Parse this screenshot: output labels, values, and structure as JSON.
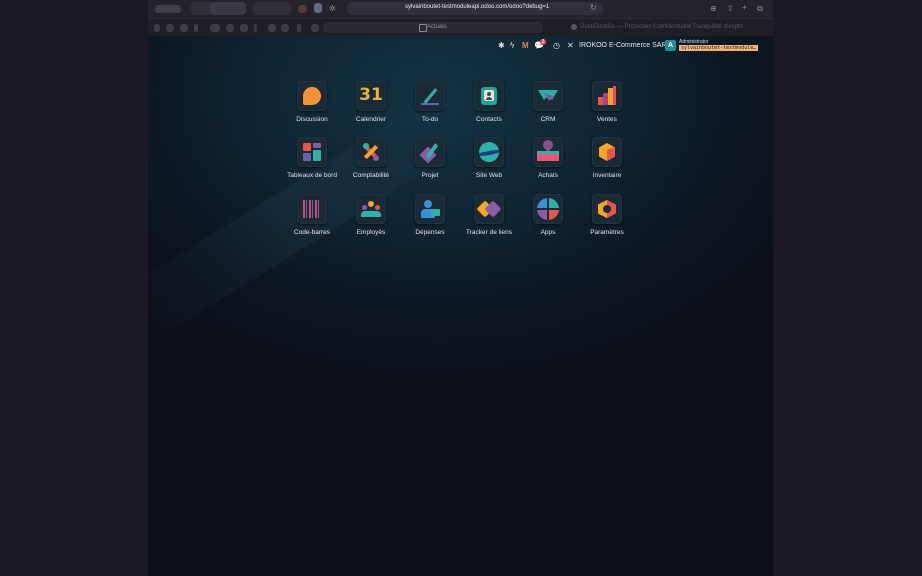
{
  "browser": {
    "url": "sylvainboutet-testmoduleapi.odoo.com/odoo?debug=1",
    "tab_label": "Actuals",
    "tab_info": "DuckDuckGo — Protection   Confidentialité   Tranquillité d'esprit"
  },
  "navbar": {
    "notification_count": "3",
    "company": "IROKOO E-Commerce SARL",
    "avatar_letter": "A",
    "user": "Administrator",
    "database": "sylvainboutet-testmodule…"
  },
  "apps": [
    {
      "label": "Discussion",
      "icon": "discussion-icon"
    },
    {
      "label": "Calendrier",
      "icon": "calendar-icon",
      "glyph": "31"
    },
    {
      "label": "To-do",
      "icon": "todo-icon"
    },
    {
      "label": "Contacts",
      "icon": "contacts-icon"
    },
    {
      "label": "CRM",
      "icon": "crm-icon"
    },
    {
      "label": "Ventes",
      "icon": "sales-icon"
    },
    {
      "label": "Tableaux de bord",
      "icon": "dashboard-icon"
    },
    {
      "label": "Comptabilité",
      "icon": "accounting-icon"
    },
    {
      "label": "Projet",
      "icon": "project-icon"
    },
    {
      "label": "Site Web",
      "icon": "website-icon"
    },
    {
      "label": "Achats",
      "icon": "purchase-icon"
    },
    {
      "label": "Inventaire",
      "icon": "inventory-icon"
    },
    {
      "label": "Code-barres",
      "icon": "barcode-icon"
    },
    {
      "label": "Employés",
      "icon": "employees-icon"
    },
    {
      "label": "Dépenses",
      "icon": "expenses-icon"
    },
    {
      "label": "Tracker de liens",
      "icon": "link-tracker-icon"
    },
    {
      "label": "Apps",
      "icon": "apps-icon"
    },
    {
      "label": "Paramètres",
      "icon": "settings-icon"
    }
  ]
}
